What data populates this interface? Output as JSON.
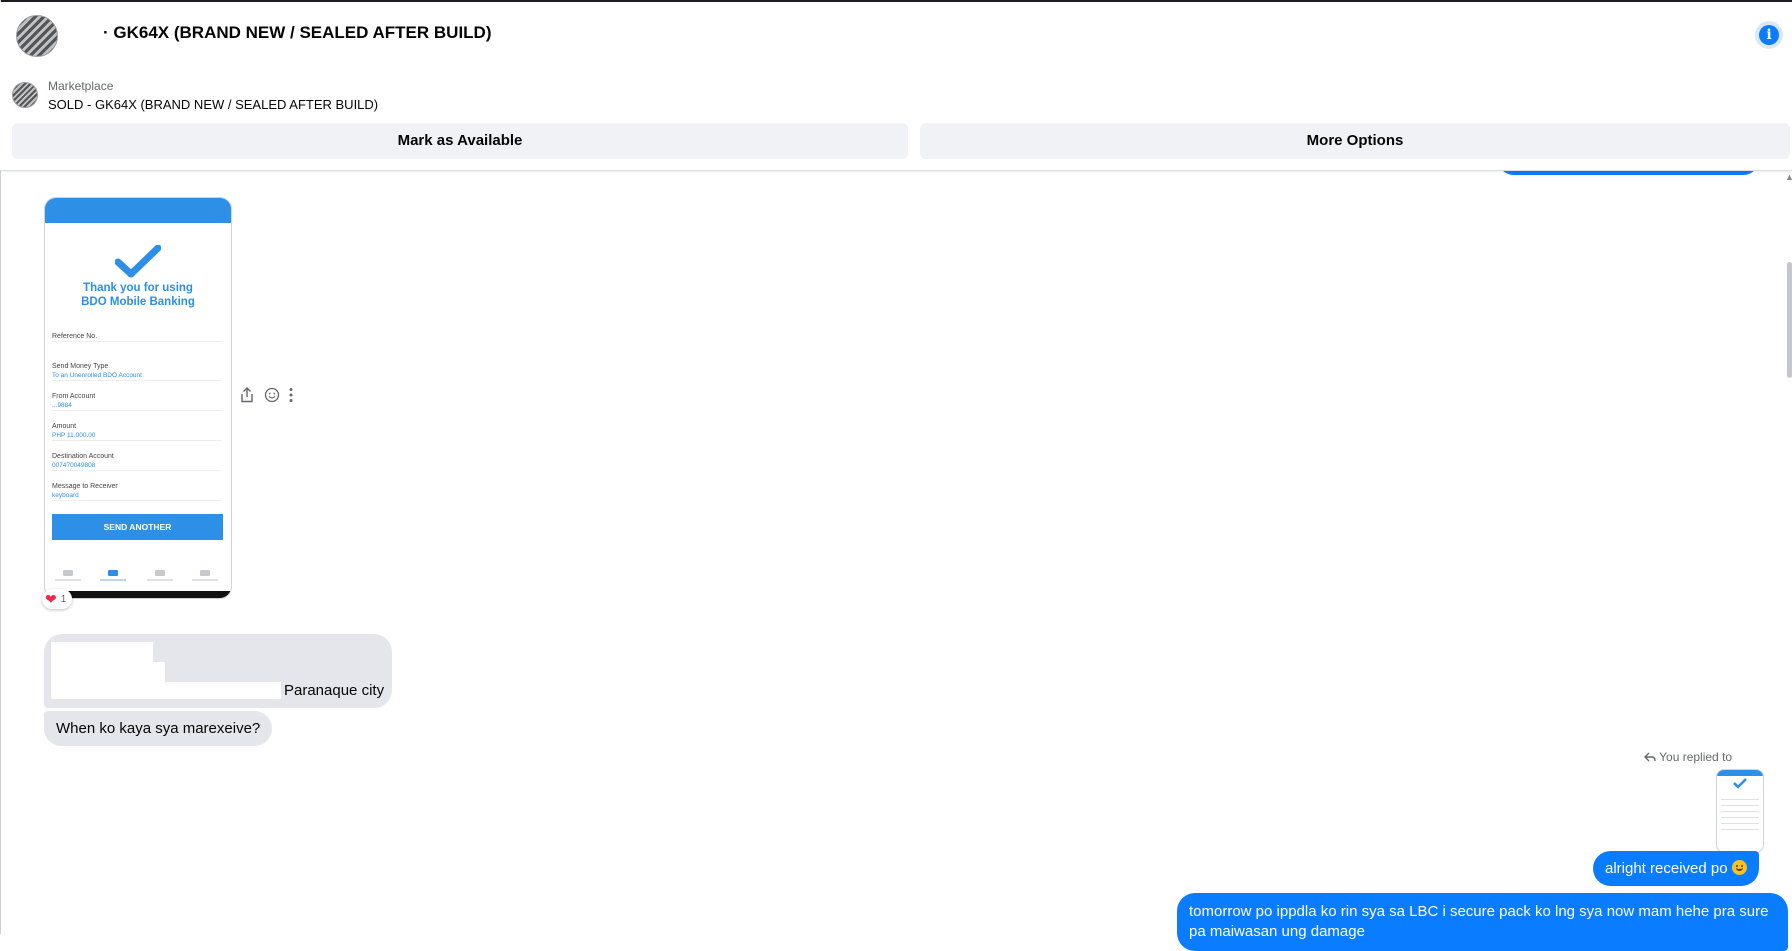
{
  "header": {
    "title": "· GK64X (BRAND NEW / SEALED AFTER BUILD)",
    "marketplace_label": "Marketplace",
    "listing_title": "SOLD - GK64X (BRAND NEW / SEALED AFTER BUILD)",
    "info_icon": "info-icon",
    "mark_available_label": "Mark as Available",
    "more_options_label": "More Options"
  },
  "receipt": {
    "thanks_line1": "Thank you for using",
    "thanks_line2": "BDO Mobile Banking",
    "fields": [
      {
        "label": "Reference No.",
        "value": ""
      },
      {
        "label": "Send Money Type",
        "value": "To an Unenrolled BDO Account"
      },
      {
        "label": "From Account",
        "value": "...9884"
      },
      {
        "label": "Amount",
        "value": "PHP 11,000.00"
      },
      {
        "label": "Destination Account",
        "value": "007470049808"
      },
      {
        "label": "Message to Receiver",
        "value": "keyboard"
      }
    ],
    "send_another": "SEND ANOTHER"
  },
  "reaction": {
    "emoji": "❤",
    "count": "1"
  },
  "messages": {
    "address_text": "Paranaque city",
    "when_text": "When ko kaya sya marexeive?",
    "replied_label": "You replied to",
    "alright_text": "alright received po",
    "tomorrow_text": "tomorrow po ippdla ko rin sya sa LBC i secure pack ko lng sya now mam hehe pra sure pa maiwasan ung damage"
  },
  "colors": {
    "messenger_blue": "#0a7cff",
    "bdo_blue": "#2d8fe6",
    "incoming_bubble": "#e4e6eb"
  }
}
